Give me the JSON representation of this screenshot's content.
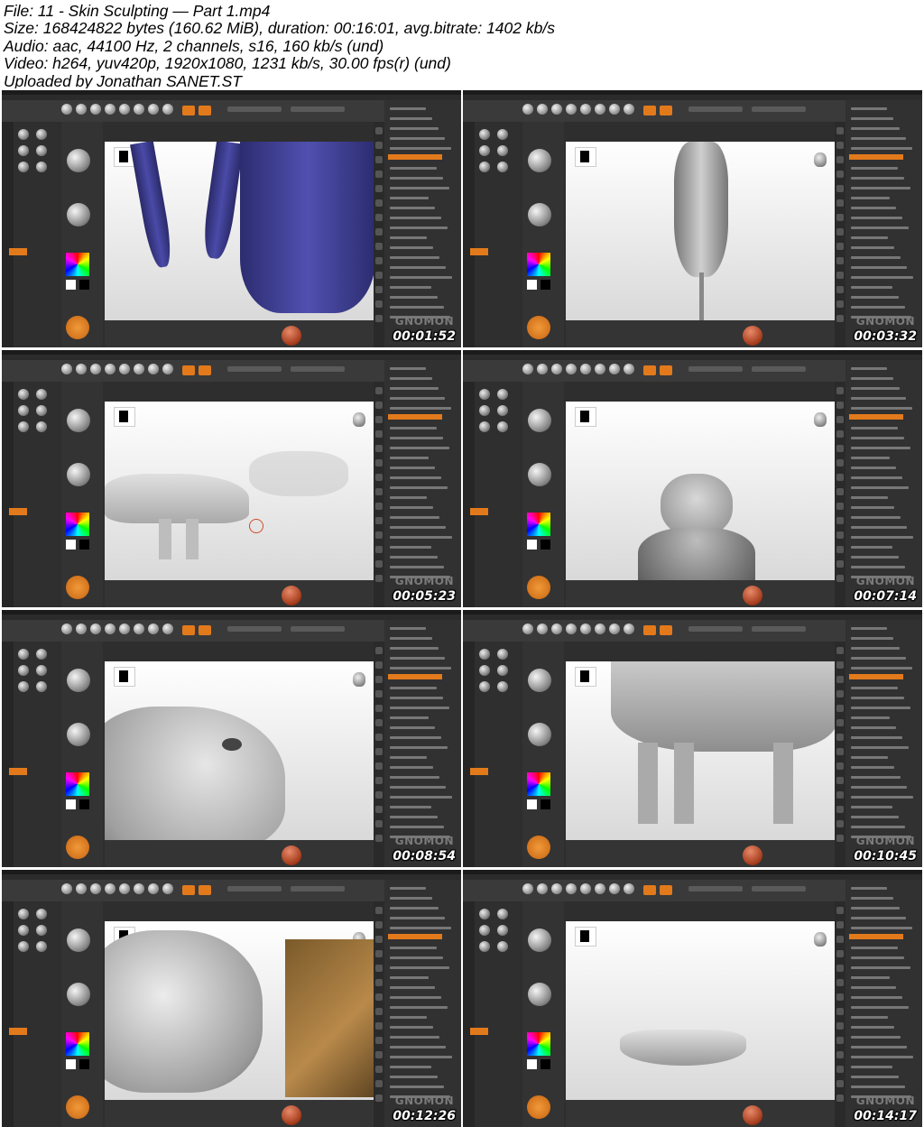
{
  "header": {
    "file": "File: 11 - Skin Sculpting — Part 1.mp4",
    "size": "Size: 168424822 bytes (160.62 MiB), duration: 00:16:01, avg.bitrate: 1402 kb/s",
    "audio": "Audio: aac, 44100 Hz, 2 channels, s16, 160 kb/s (und)",
    "video": "Video: h264, yuv420p, 1920x1080, 1231 kb/s, 30.00 fps(r) (und)",
    "uploader": "Uploaded by Jonathan SANET.ST"
  },
  "watermark": "GNOMON",
  "thumbnails": [
    {
      "timestamp": "00:01:52",
      "subject": "dog-legs-blue-wireframe"
    },
    {
      "timestamp": "00:03:32",
      "subject": "upside-down-creature"
    },
    {
      "timestamp": "00:05:23",
      "subject": "dog-side-view-with-ghost"
    },
    {
      "timestamp": "00:07:14",
      "subject": "creature-front-head"
    },
    {
      "timestamp": "00:08:54",
      "subject": "snout-closeup"
    },
    {
      "timestamp": "00:10:45",
      "subject": "dog-body-legs"
    },
    {
      "timestamp": "00:12:26",
      "subject": "head-with-reference-photo"
    },
    {
      "timestamp": "00:14:17",
      "subject": "jaw-teeth-model"
    }
  ],
  "colors": {
    "ui_bg": "#2e2e2e",
    "accent_orange": "#e27a1c",
    "wireframe_blue": "#3c3c8c",
    "clay": "#b8b8b8"
  }
}
